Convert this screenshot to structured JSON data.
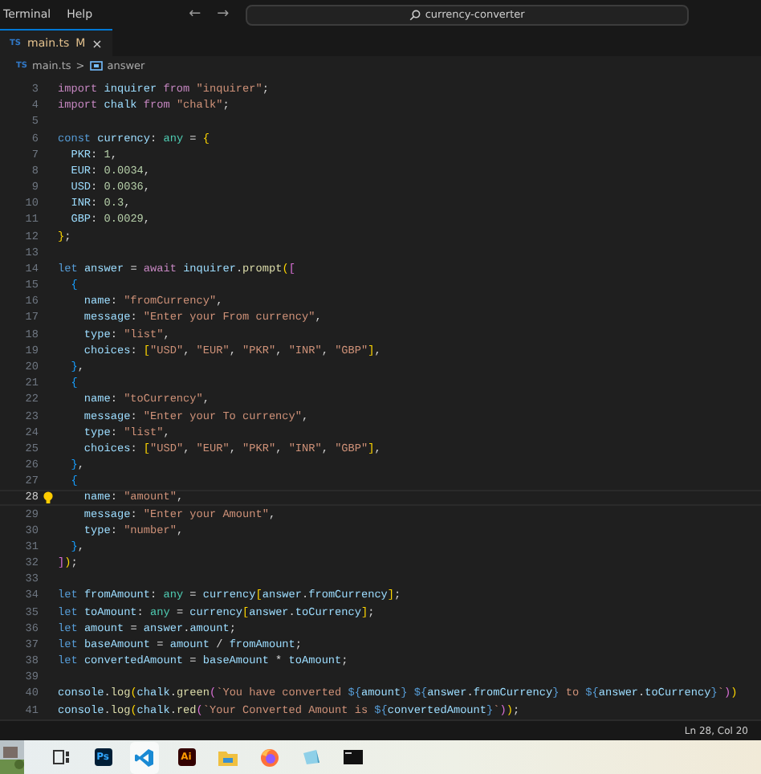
{
  "title_bar": {
    "menu": [
      "Terminal",
      "Help"
    ],
    "back": "←",
    "forward": "→",
    "search": "currency-converter"
  },
  "tabs": [
    {
      "icon": "TS",
      "label": "main.ts",
      "badge": "M",
      "close": "×",
      "selected": true
    }
  ],
  "breadcrumb": {
    "icon": "TS",
    "file": "main.ts",
    "separator": ">",
    "symbol": "answer"
  },
  "lines": [
    {
      "number": "3",
      "current": false,
      "tokens": [
        {
          "kind": "c",
          "text": "import "
        },
        {
          "kind": "v",
          "text": "inquirer "
        },
        {
          "kind": "c",
          "text": "from "
        },
        {
          "kind": "s",
          "text": "\"inquirer\""
        },
        {
          "kind": "p",
          "text": ";"
        }
      ]
    },
    {
      "number": "4",
      "current": false,
      "tokens": [
        {
          "kind": "c",
          "text": "import "
        },
        {
          "kind": "v",
          "text": "chalk "
        },
        {
          "kind": "c",
          "text": "from "
        },
        {
          "kind": "s",
          "text": "\"chalk\""
        },
        {
          "kind": "p",
          "text": ";"
        }
      ]
    },
    {
      "number": "5",
      "current": false
    },
    {
      "number": "6",
      "current": false,
      "tokens": [
        {
          "kind": "k",
          "text": "const "
        },
        {
          "kind": "v",
          "text": "currency"
        },
        {
          "kind": "p",
          "text": ": "
        },
        {
          "kind": "t",
          "text": "any"
        },
        {
          "kind": "p",
          "text": " = "
        },
        {
          "kind": "b",
          "text": "{"
        }
      ]
    },
    {
      "number": "7",
      "current": false,
      "tokens": [
        {
          "kind": "v",
          "text": "  PKR"
        },
        {
          "kind": "p",
          "text": ": "
        },
        {
          "kind": "n",
          "text": "1"
        },
        {
          "kind": "p",
          "text": ","
        }
      ]
    },
    {
      "number": "8",
      "current": false,
      "tokens": [
        {
          "kind": "v",
          "text": "  EUR"
        },
        {
          "kind": "p",
          "text": ": "
        },
        {
          "kind": "n",
          "text": "0.0034"
        },
        {
          "kind": "p",
          "text": ","
        }
      ]
    },
    {
      "number": "9",
      "current": false,
      "tokens": [
        {
          "kind": "v",
          "text": "  USD"
        },
        {
          "kind": "p",
          "text": ": "
        },
        {
          "kind": "n",
          "text": "0.0036"
        },
        {
          "kind": "p",
          "text": ","
        }
      ]
    },
    {
      "number": "10",
      "current": false,
      "tokens": [
        {
          "kind": "v",
          "text": "  INR"
        },
        {
          "kind": "p",
          "text": ": "
        },
        {
          "kind": "n",
          "text": "0.3"
        },
        {
          "kind": "p",
          "text": ","
        }
      ]
    },
    {
      "number": "11",
      "current": false,
      "tokens": [
        {
          "kind": "v",
          "text": "  GBP"
        },
        {
          "kind": "p",
          "text": ": "
        },
        {
          "kind": "n",
          "text": "0.0029"
        },
        {
          "kind": "p",
          "text": ","
        }
      ]
    },
    {
      "number": "12",
      "current": false,
      "tokens": [
        {
          "kind": "b",
          "text": "}"
        },
        {
          "kind": "p",
          "text": ";"
        }
      ]
    },
    {
      "number": "13",
      "current": false
    },
    {
      "number": "14",
      "current": false,
      "tokens": [
        {
          "kind": "k",
          "text": "let "
        },
        {
          "kind": "v",
          "text": "answer"
        },
        {
          "kind": "p",
          "text": " = "
        },
        {
          "kind": "c",
          "text": "await "
        },
        {
          "kind": "v",
          "text": "inquirer"
        },
        {
          "kind": "p",
          "text": "."
        },
        {
          "kind": "f",
          "text": "prompt"
        },
        {
          "kind": "b",
          "text": "("
        },
        {
          "kind": "m",
          "text": "["
        }
      ]
    },
    {
      "number": "15",
      "current": false,
      "tokens": [
        {
          "kind": "l",
          "text": "  {"
        }
      ]
    },
    {
      "number": "16",
      "current": false,
      "tokens": [
        {
          "kind": "v",
          "text": "    name"
        },
        {
          "kind": "p",
          "text": ": "
        },
        {
          "kind": "s",
          "text": "\"fromCurrency\""
        },
        {
          "kind": "p",
          "text": ","
        }
      ]
    },
    {
      "number": "17",
      "current": false,
      "tokens": [
        {
          "kind": "v",
          "text": "    message"
        },
        {
          "kind": "p",
          "text": ": "
        },
        {
          "kind": "s",
          "text": "\"Enter your From currency\""
        },
        {
          "kind": "p",
          "text": ","
        }
      ]
    },
    {
      "number": "18",
      "current": false,
      "tokens": [
        {
          "kind": "v",
          "text": "    type"
        },
        {
          "kind": "p",
          "text": ": "
        },
        {
          "kind": "s",
          "text": "\"list\""
        },
        {
          "kind": "p",
          "text": ","
        }
      ]
    },
    {
      "number": "19",
      "current": false,
      "tokens": [
        {
          "kind": "v",
          "text": "    choices"
        },
        {
          "kind": "p",
          "text": ": "
        },
        {
          "kind": "b",
          "text": "["
        },
        {
          "kind": "s",
          "text": "\"USD\""
        },
        {
          "kind": "p",
          "text": ", "
        },
        {
          "kind": "s",
          "text": "\"EUR\""
        },
        {
          "kind": "p",
          "text": ", "
        },
        {
          "kind": "s",
          "text": "\"PKR\""
        },
        {
          "kind": "p",
          "text": ", "
        },
        {
          "kind": "s",
          "text": "\"INR\""
        },
        {
          "kind": "p",
          "text": ", "
        },
        {
          "kind": "s",
          "text": "\"GBP\""
        },
        {
          "kind": "b",
          "text": "]"
        },
        {
          "kind": "p",
          "text": ","
        }
      ]
    },
    {
      "number": "20",
      "current": false,
      "tokens": [
        {
          "kind": "l",
          "text": "  }"
        },
        {
          "kind": "p",
          "text": ","
        }
      ]
    },
    {
      "number": "21",
      "current": false,
      "tokens": [
        {
          "kind": "l",
          "text": "  {"
        }
      ]
    },
    {
      "number": "22",
      "current": false,
      "tokens": [
        {
          "kind": "v",
          "text": "    name"
        },
        {
          "kind": "p",
          "text": ": "
        },
        {
          "kind": "s",
          "text": "\"toCurrency\""
        },
        {
          "kind": "p",
          "text": ","
        }
      ]
    },
    {
      "number": "23",
      "current": false,
      "tokens": [
        {
          "kind": "v",
          "text": "    message"
        },
        {
          "kind": "p",
          "text": ": "
        },
        {
          "kind": "s",
          "text": "\"Enter your To currency\""
        },
        {
          "kind": "p",
          "text": ","
        }
      ]
    },
    {
      "number": "24",
      "current": false,
      "tokens": [
        {
          "kind": "v",
          "text": "    type"
        },
        {
          "kind": "p",
          "text": ": "
        },
        {
          "kind": "s",
          "text": "\"list\""
        },
        {
          "kind": "p",
          "text": ","
        }
      ]
    },
    {
      "number": "25",
      "current": false,
      "tokens": [
        {
          "kind": "v",
          "text": "    choices"
        },
        {
          "kind": "p",
          "text": ": "
        },
        {
          "kind": "b",
          "text": "["
        },
        {
          "kind": "s",
          "text": "\"USD\""
        },
        {
          "kind": "p",
          "text": ", "
        },
        {
          "kind": "s",
          "text": "\"EUR\""
        },
        {
          "kind": "p",
          "text": ", "
        },
        {
          "kind": "s",
          "text": "\"PKR\""
        },
        {
          "kind": "p",
          "text": ", "
        },
        {
          "kind": "s",
          "text": "\"INR\""
        },
        {
          "kind": "p",
          "text": ", "
        },
        {
          "kind": "s",
          "text": "\"GBP\""
        },
        {
          "kind": "b",
          "text": "]"
        },
        {
          "kind": "p",
          "text": ","
        }
      ]
    },
    {
      "number": "26",
      "current": false,
      "tokens": [
        {
          "kind": "l",
          "text": "  }"
        },
        {
          "kind": "p",
          "text": ","
        }
      ]
    },
    {
      "number": "27",
      "current": false,
      "tokens": [
        {
          "kind": "l",
          "text": "  {"
        }
      ]
    },
    {
      "number": "28",
      "current": true,
      "tokens": [
        {
          "kind": "v",
          "text": "    name"
        },
        {
          "kind": "p",
          "text": ": "
        },
        {
          "kind": "s",
          "text": "\"amount\""
        },
        {
          "kind": "p",
          "text": ","
        }
      ]
    },
    {
      "number": "29",
      "current": false,
      "tokens": [
        {
          "kind": "v",
          "text": "    message"
        },
        {
          "kind": "p",
          "text": ": "
        },
        {
          "kind": "s",
          "text": "\"Enter your Amount\""
        },
        {
          "kind": "p",
          "text": ","
        }
      ]
    },
    {
      "number": "30",
      "current": false,
      "tokens": [
        {
          "kind": "v",
          "text": "    type"
        },
        {
          "kind": "p",
          "text": ": "
        },
        {
          "kind": "s",
          "text": "\"number\""
        },
        {
          "kind": "p",
          "text": ","
        }
      ]
    },
    {
      "number": "31",
      "current": false,
      "tokens": [
        {
          "kind": "l",
          "text": "  }"
        },
        {
          "kind": "p",
          "text": ","
        }
      ]
    },
    {
      "number": "32",
      "current": false,
      "tokens": [
        {
          "kind": "m",
          "text": "]"
        },
        {
          "kind": "b",
          "text": ")"
        },
        {
          "kind": "p",
          "text": ";"
        }
      ]
    },
    {
      "number": "33",
      "current": false
    },
    {
      "number": "34",
      "current": false,
      "tokens": [
        {
          "kind": "k",
          "text": "let "
        },
        {
          "kind": "v",
          "text": "fromAmount"
        },
        {
          "kind": "p",
          "text": ": "
        },
        {
          "kind": "t",
          "text": "any"
        },
        {
          "kind": "p",
          "text": " = "
        },
        {
          "kind": "v",
          "text": "currency"
        },
        {
          "kind": "b",
          "text": "["
        },
        {
          "kind": "v",
          "text": "answer"
        },
        {
          "kind": "p",
          "text": "."
        },
        {
          "kind": "v",
          "text": "fromCurrency"
        },
        {
          "kind": "b",
          "text": "]"
        },
        {
          "kind": "p",
          "text": ";"
        }
      ]
    },
    {
      "number": "35",
      "current": false,
      "tokens": [
        {
          "kind": "k",
          "text": "let "
        },
        {
          "kind": "v",
          "text": "toAmount"
        },
        {
          "kind": "p",
          "text": ": "
        },
        {
          "kind": "t",
          "text": "any"
        },
        {
          "kind": "p",
          "text": " = "
        },
        {
          "kind": "v",
          "text": "currency"
        },
        {
          "kind": "b",
          "text": "["
        },
        {
          "kind": "v",
          "text": "answer"
        },
        {
          "kind": "p",
          "text": "."
        },
        {
          "kind": "v",
          "text": "toCurrency"
        },
        {
          "kind": "b",
          "text": "]"
        },
        {
          "kind": "p",
          "text": ";"
        }
      ]
    },
    {
      "number": "36",
      "current": false,
      "tokens": [
        {
          "kind": "k",
          "text": "let "
        },
        {
          "kind": "v",
          "text": "amount"
        },
        {
          "kind": "p",
          "text": " = "
        },
        {
          "kind": "v",
          "text": "answer"
        },
        {
          "kind": "p",
          "text": "."
        },
        {
          "kind": "v",
          "text": "amount"
        },
        {
          "kind": "p",
          "text": ";"
        }
      ]
    },
    {
      "number": "37",
      "current": false,
      "tokens": [
        {
          "kind": "k",
          "text": "let "
        },
        {
          "kind": "v",
          "text": "baseAmount"
        },
        {
          "kind": "p",
          "text": " = "
        },
        {
          "kind": "v",
          "text": "amount"
        },
        {
          "kind": "p",
          "text": " / "
        },
        {
          "kind": "v",
          "text": "fromAmount"
        },
        {
          "kind": "p",
          "text": ";"
        }
      ]
    },
    {
      "number": "38",
      "current": false,
      "tokens": [
        {
          "kind": "k",
          "text": "let "
        },
        {
          "kind": "v",
          "text": "convertedAmount"
        },
        {
          "kind": "p",
          "text": " = "
        },
        {
          "kind": "v",
          "text": "baseAmount"
        },
        {
          "kind": "p",
          "text": " * "
        },
        {
          "kind": "v",
          "text": "toAmount"
        },
        {
          "kind": "p",
          "text": ";"
        }
      ]
    },
    {
      "number": "39",
      "current": false
    },
    {
      "number": "40",
      "current": false,
      "tokens": [
        {
          "kind": "v",
          "text": "console"
        },
        {
          "kind": "p",
          "text": "."
        },
        {
          "kind": "f",
          "text": "log"
        },
        {
          "kind": "b",
          "text": "("
        },
        {
          "kind": "v",
          "text": "chalk"
        },
        {
          "kind": "p",
          "text": "."
        },
        {
          "kind": "f",
          "text": "green"
        },
        {
          "kind": "m",
          "text": "("
        },
        {
          "kind": "s",
          "text": "`You have converted "
        },
        {
          "kind": "k",
          "text": "${"
        },
        {
          "kind": "v",
          "text": "amount"
        },
        {
          "kind": "k",
          "text": "} "
        },
        {
          "kind": "k",
          "text": "${"
        },
        {
          "kind": "v",
          "text": "answer"
        },
        {
          "kind": "p",
          "text": "."
        },
        {
          "kind": "v",
          "text": "fromCurrency"
        },
        {
          "kind": "k",
          "text": "}"
        },
        {
          "kind": "s",
          "text": " to "
        },
        {
          "kind": "k",
          "text": "${"
        },
        {
          "kind": "v",
          "text": "answer"
        },
        {
          "kind": "p",
          "text": "."
        },
        {
          "kind": "v",
          "text": "toCurrency"
        },
        {
          "kind": "k",
          "text": "}"
        },
        {
          "kind": "s",
          "text": "`"
        },
        {
          "kind": "m",
          "text": ")"
        },
        {
          "kind": "b",
          "text": ")"
        }
      ]
    },
    {
      "number": "41",
      "current": false,
      "tokens": [
        {
          "kind": "v",
          "text": "console"
        },
        {
          "kind": "p",
          "text": "."
        },
        {
          "kind": "f",
          "text": "log"
        },
        {
          "kind": "b",
          "text": "("
        },
        {
          "kind": "v",
          "text": "chalk"
        },
        {
          "kind": "p",
          "text": "."
        },
        {
          "kind": "f",
          "text": "red"
        },
        {
          "kind": "m",
          "text": "("
        },
        {
          "kind": "s",
          "text": "`Your Converted Amount is "
        },
        {
          "kind": "k",
          "text": "${"
        },
        {
          "kind": "v",
          "text": "convertedAmount"
        },
        {
          "kind": "k",
          "text": "}"
        },
        {
          "kind": "s",
          "text": "`"
        },
        {
          "kind": "m",
          "text": ")"
        },
        {
          "kind": "b",
          "text": ")"
        },
        {
          "kind": "p",
          "text": ";"
        }
      ]
    }
  ],
  "status_bar": {
    "position": "Ln 28, Col 20"
  },
  "taskbar": [
    {
      "kind": "picture"
    },
    {
      "kind": "taskview",
      "selected": false
    },
    {
      "kind": "ps",
      "label": "Ps",
      "selected": false
    },
    {
      "kind": "vscode",
      "selected": true
    },
    {
      "kind": "ai",
      "label": "Ai",
      "selected": false
    },
    {
      "kind": "folder",
      "selected": false
    },
    {
      "kind": "firefox",
      "selected": false
    },
    {
      "kind": "app",
      "selected": false
    },
    {
      "kind": "terminal",
      "selected": false
    }
  ]
}
